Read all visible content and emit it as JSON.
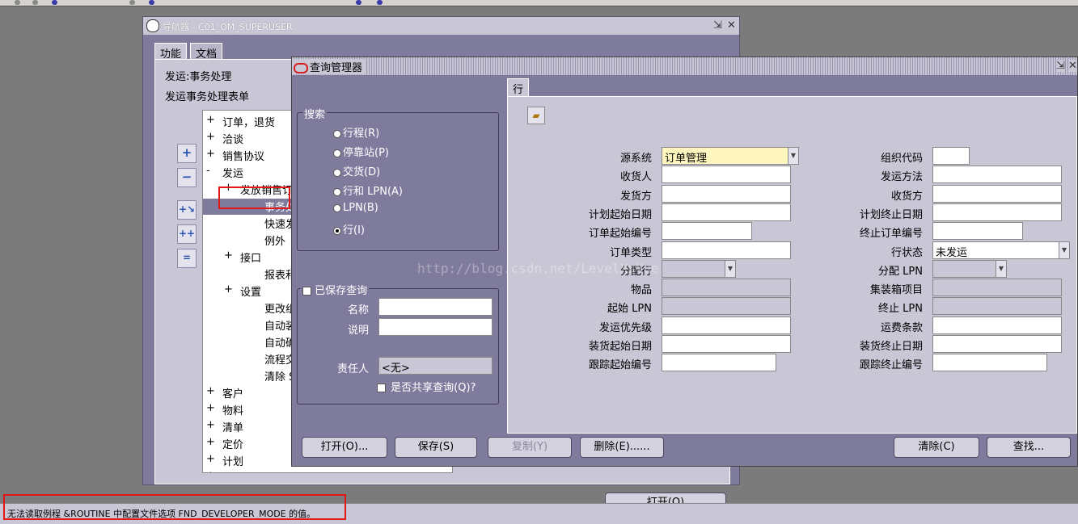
{
  "navigator": {
    "title": "导航器 - C01_OM_SUPERUSER",
    "tabs": [
      "功能",
      "文档"
    ],
    "line1": "发运:事务处理",
    "line2": "发运事务处理表单",
    "tree": [
      {
        "mark": "+",
        "label": "订单，退货"
      },
      {
        "mark": "+",
        "label": "洽谈"
      },
      {
        "mark": "+",
        "label": "销售协议"
      },
      {
        "mark": "-",
        "label": "发运"
      },
      {
        "mark": "+",
        "label": "发放销售订单"
      },
      {
        "mark": "",
        "label": "事务处理"
      },
      {
        "mark": "",
        "label": "快速发运"
      },
      {
        "mark": "",
        "label": "例外"
      },
      {
        "mark": "+",
        "label": "接口"
      },
      {
        "mark": "",
        "label": "报表和单据"
      },
      {
        "mark": "+",
        "label": "设置"
      },
      {
        "mark": "",
        "label": "更改组织"
      },
      {
        "mark": "",
        "label": "自动装箱交货"
      },
      {
        "mark": "",
        "label": "自动确认交货"
      },
      {
        "mark": "",
        "label": "流程交货 SRS"
      },
      {
        "mark": "",
        "label": "清除 SRS"
      },
      {
        "mark": "+",
        "label": "客户"
      },
      {
        "mark": "+",
        "label": "物料"
      },
      {
        "mark": "+",
        "label": "清单"
      },
      {
        "mark": "+",
        "label": "定价"
      },
      {
        "mark": "+",
        "label": "计划"
      },
      {
        "mark": "+",
        "label": "设置"
      }
    ],
    "open_button": "打开(O)"
  },
  "query_manager": {
    "title": "查询管理器",
    "search_group": "搜索",
    "search_options": [
      "行程(R)",
      "停靠站(P)",
      "交货(D)",
      "行和 LPN(A)",
      "LPN(B)",
      "行(I)"
    ],
    "selected_option": "行(I)",
    "saved_query": {
      "label": "已保存查询",
      "name_label": "名称",
      "desc_label": "说明",
      "owner_label": "责任人",
      "owner_value": "<无>",
      "shared_label": "是否共享查询(Q)?"
    },
    "row_tab": "行",
    "left_fields": [
      {
        "label": "源系统",
        "value": "订单管理"
      },
      {
        "label": "收货人",
        "value": ""
      },
      {
        "label": "发货方",
        "value": ""
      },
      {
        "label": "计划起始日期",
        "value": ""
      },
      {
        "label": "订单起始编号",
        "value": ""
      },
      {
        "label": "订单类型",
        "value": ""
      },
      {
        "label": "分配行",
        "value": ""
      },
      {
        "label": "物品",
        "value": ""
      },
      {
        "label": "起始 LPN",
        "value": ""
      },
      {
        "label": "发运优先级",
        "value": ""
      },
      {
        "label": "装货起始日期",
        "value": ""
      },
      {
        "label": "跟踪起始编号",
        "value": ""
      }
    ],
    "right_fields": [
      {
        "label": "组织代码",
        "value": ""
      },
      {
        "label": "发运方法",
        "value": ""
      },
      {
        "label": "收货方",
        "value": ""
      },
      {
        "label": "计划终止日期",
        "value": ""
      },
      {
        "label": "终止订单编号",
        "value": ""
      },
      {
        "label": "行状态",
        "value": "未发运"
      },
      {
        "label": "分配 LPN",
        "value": ""
      },
      {
        "label": "集装箱项目",
        "value": ""
      },
      {
        "label": "终止 LPN",
        "value": ""
      },
      {
        "label": "运费条款",
        "value": ""
      },
      {
        "label": "装货终止日期",
        "value": ""
      },
      {
        "label": "跟踪终止编号",
        "value": ""
      }
    ],
    "buttons": {
      "open": "打开(O)...",
      "save": "保存(S)",
      "copy": "复制(Y)",
      "delete": "删除(E)......",
      "clear": "清除(C)",
      "find": "查找..."
    }
  },
  "watermark": "http://blog.csdn.net/LevelXuYue",
  "status_message": "无法读取例程 &ROUTINE 中配置文件选项 FND_DEVELOPER_MODE 的值。"
}
